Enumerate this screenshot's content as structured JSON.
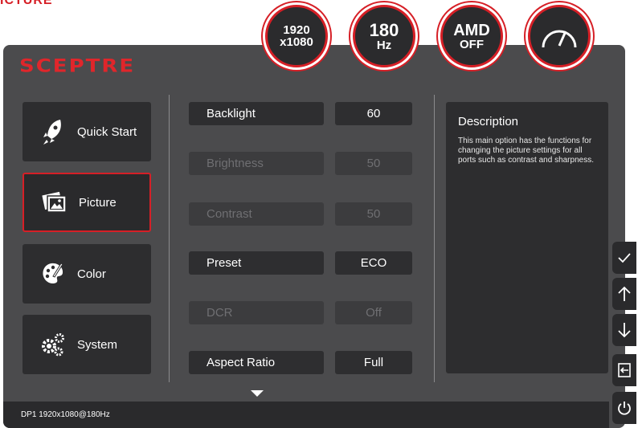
{
  "header": {
    "top_left_text": "ICTURE"
  },
  "badges": [
    {
      "line1": "1920",
      "line2": "x1080"
    },
    {
      "line1": "180",
      "line2": "Hz"
    },
    {
      "line1": "AMD",
      "line2": "OFF"
    },
    {
      "icon": "speedometer-icon"
    }
  ],
  "brand": {
    "logo": "SCEPTRE"
  },
  "nav": [
    {
      "label": "Quick Start",
      "icon": "rocket-icon",
      "active": false
    },
    {
      "label": "Picture",
      "icon": "picture-icon",
      "active": true
    },
    {
      "label": "Color",
      "icon": "palette-icon",
      "active": false
    },
    {
      "label": "System",
      "icon": "gears-icon",
      "active": false
    }
  ],
  "settings": [
    {
      "label": "Backlight",
      "value": "60",
      "enabled": true
    },
    {
      "label": "Brightness",
      "value": "50",
      "enabled": false
    },
    {
      "label": "Contrast",
      "value": "50",
      "enabled": false
    },
    {
      "label": "Preset",
      "value": "ECO",
      "enabled": true
    },
    {
      "label": "DCR",
      "value": "Off",
      "enabled": false
    },
    {
      "label": "Aspect Ratio",
      "value": "Full",
      "enabled": true
    }
  ],
  "description": {
    "title": "Description",
    "text": "This main option has the functions for changing the picture settings for all ports such as contrast and sharpness."
  },
  "status": {
    "text": "DP1 1920x1080@180Hz"
  },
  "side_buttons": [
    {
      "icon": "check-icon"
    },
    {
      "icon": "arrow-up-icon"
    },
    {
      "icon": "arrow-down-icon"
    },
    {
      "icon": "exit-icon"
    },
    {
      "icon": "power-icon"
    }
  ],
  "colors": {
    "accent": "#d61f26",
    "panel": "#4b4b4d",
    "button": "#2d2d2f"
  }
}
